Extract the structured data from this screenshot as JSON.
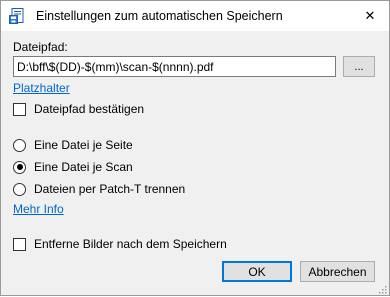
{
  "window": {
    "title": "Einstellungen zum automatischen Speichern",
    "close_glyph": "✕",
    "icon": "save-document-icon"
  },
  "filepath": {
    "label": "Dateipfad:",
    "value": "D:\\bff\\$(DD)-$(mm)\\scan-$(nnnn).pdf",
    "browse_label": "...",
    "placeholder_link": "Platzhalter"
  },
  "confirm_path": {
    "label": "Dateipfad bestätigen",
    "checked": false
  },
  "split_options": [
    {
      "label": "Eine Datei je Seite",
      "checked": false
    },
    {
      "label": "Eine Datei je Scan",
      "checked": true
    },
    {
      "label": "Dateien per Patch-T trennen",
      "checked": false
    }
  ],
  "more_info_link": "Mehr Info",
  "remove_images": {
    "label": "Entferne Bilder nach dem Speichern",
    "checked": false
  },
  "buttons": {
    "ok": "OK",
    "cancel": "Abbrechen"
  },
  "colors": {
    "link": "#0066cc",
    "default_button_border": "#0078d7",
    "dialog_bg": "#f0f0f0"
  }
}
